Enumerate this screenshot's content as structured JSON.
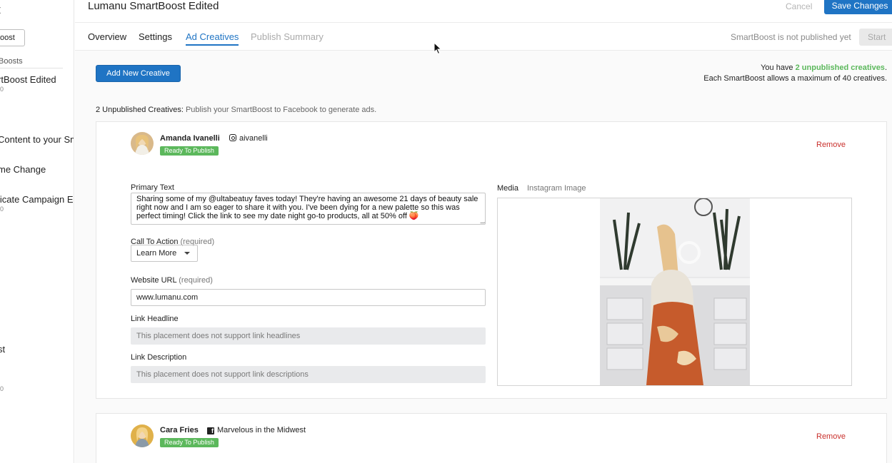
{
  "sidebar": {
    "title": "t",
    "new_button": "oost",
    "section_label": "Boosts",
    "items": [
      {
        "label": "rtBoost Edited",
        "sub": "0"
      },
      {
        "label": "Content to your Sm",
        "sub": ""
      },
      {
        "label": "me Change",
        "sub": ""
      },
      {
        "label": "licate Campaign E",
        "sub": "0"
      },
      {
        "label": "st",
        "sub": "0"
      }
    ]
  },
  "header": {
    "title": "Lumanu SmartBoost Edited",
    "cancel_label": "Cancel",
    "save_label": "Save Changes"
  },
  "tabs": {
    "overview": "Overview",
    "settings": "Settings",
    "ad_creatives": "Ad Creatives",
    "publish_summary": "Publish Summary",
    "status_text": "SmartBoost is not published yet",
    "start_label": "Start"
  },
  "creatives_header": {
    "add_button": "Add New Creative",
    "info_prefix": "You have ",
    "info_highlight": "2 unpublished creatives",
    "info_suffix": ".",
    "info_line2": "Each SmartBoost allows a maximum of 40 creatives.",
    "unpublished_count_label": "2 Unpublished Creatives:",
    "unpublished_hint": "Publish your SmartBoost to Facebook to generate ads."
  },
  "creatives": [
    {
      "author": "Amanda Ivanelli",
      "handle": "aivanelli",
      "platform_icon": "instagram-icon",
      "status": "Ready To Publish",
      "remove_label": "Remove",
      "primary_text_label": "Primary Text",
      "primary_text": "Sharing some of my @ultabeatuy faves today! They're having an awesome 21 days of beauty sale right now and I am so eager to share it with you. I've been dying for a new palette so this was perfect timing! Click the link to see my date night go-to products, all at 50% off 🍑",
      "cta_label": "Call To Action",
      "cta_req": "(required)",
      "cta_value": "Learn More",
      "url_label": "Website URL",
      "url_req": "(required)",
      "url_value": "www.lumanu.com",
      "headline_label": "Link Headline",
      "headline_placeholder": "This placement does not support link headlines",
      "description_label": "Link Description",
      "description_placeholder": "This placement does not support link descriptions",
      "media_tab": "Media",
      "media_type": "Instagram Image"
    },
    {
      "author": "Cara Fries",
      "handle": "Marvelous in the Midwest",
      "platform_icon": "facebook-icon",
      "status": "Ready To Publish",
      "remove_label": "Remove"
    }
  ],
  "colors": {
    "primary": "#1f74c4",
    "success": "#5cb85c",
    "danger": "#c9302c"
  }
}
